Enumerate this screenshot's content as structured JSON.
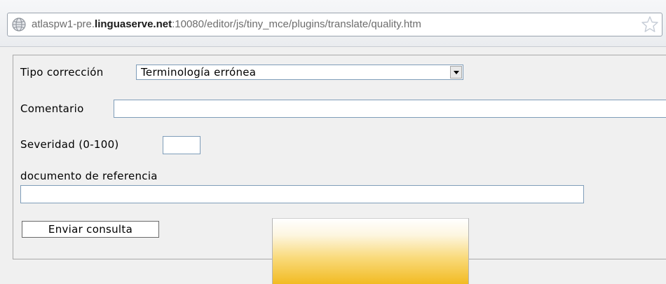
{
  "address_bar": {
    "url_prefix": "atlaspw1-pre.",
    "url_domain": "linguaserve.net",
    "url_suffix": ":10080/editor/js/tiny_mce/plugins/translate/quality.htm"
  },
  "form": {
    "tipo_label": "Tipo corrección",
    "tipo_value": "Terminología errónea",
    "comentario_label": "Comentario",
    "comentario_value": "",
    "severidad_label": "Severidad (0-100)",
    "severidad_value": "",
    "referencia_label": "documento de referencia",
    "referencia_value": "",
    "submit_label": "Enviar consulta"
  }
}
